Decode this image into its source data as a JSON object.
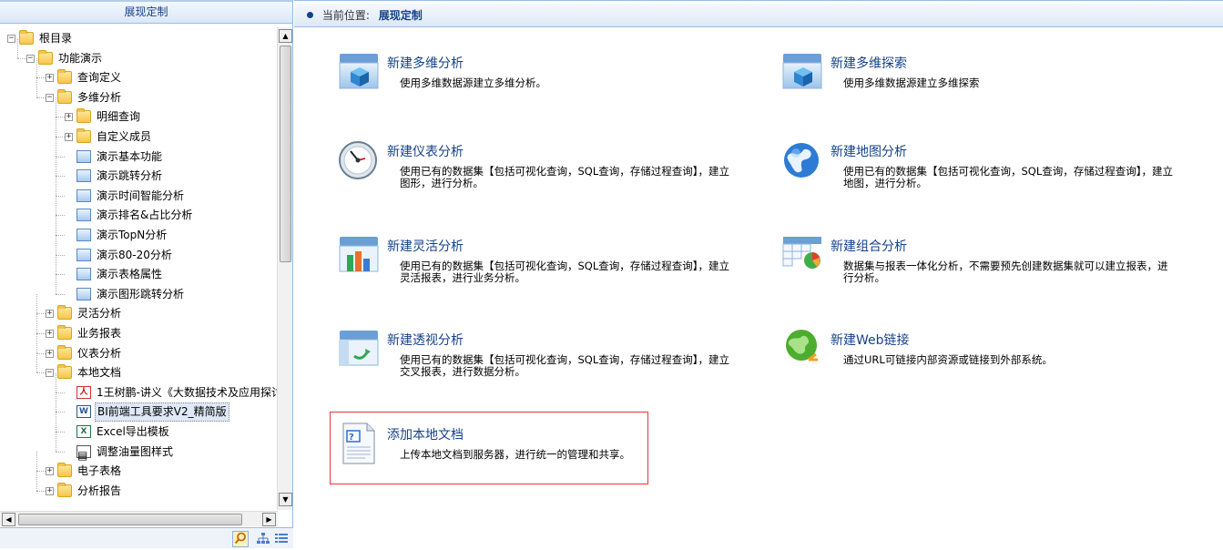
{
  "left_panel": {
    "title": "展现定制",
    "tree": [
      {
        "label": "根目录",
        "level": 0,
        "type": "folder",
        "expanded": true
      },
      {
        "label": "功能演示",
        "level": 1,
        "type": "folder",
        "expanded": true
      },
      {
        "label": "查询定义",
        "level": 2,
        "type": "folder",
        "expanded": false
      },
      {
        "label": "多维分析",
        "level": 2,
        "type": "folder",
        "expanded": true
      },
      {
        "label": "明细查询",
        "level": 3,
        "type": "folder",
        "expanded": false
      },
      {
        "label": "自定义成员",
        "level": 3,
        "type": "folder",
        "expanded": false
      },
      {
        "label": "演示基本功能",
        "level": 3,
        "type": "report"
      },
      {
        "label": "演示跳转分析",
        "level": 3,
        "type": "report"
      },
      {
        "label": "演示时间智能分析",
        "level": 3,
        "type": "report"
      },
      {
        "label": "演示排名&占比分析",
        "level": 3,
        "type": "report"
      },
      {
        "label": "演示TopN分析",
        "level": 3,
        "type": "report"
      },
      {
        "label": "演示80-20分析",
        "level": 3,
        "type": "report"
      },
      {
        "label": "演示表格属性",
        "level": 3,
        "type": "report"
      },
      {
        "label": "演示图形跳转分析",
        "level": 3,
        "type": "report"
      },
      {
        "label": "灵活分析",
        "level": 2,
        "type": "folder",
        "expanded": false
      },
      {
        "label": "业务报表",
        "level": 2,
        "type": "folder",
        "expanded": false
      },
      {
        "label": "仪表分析",
        "level": 2,
        "type": "folder",
        "expanded": false
      },
      {
        "label": "本地文档",
        "level": 2,
        "type": "folder",
        "expanded": true
      },
      {
        "label": "1王树鹏-讲义《大数据技术及应用探讨",
        "level": 3,
        "type": "pdf"
      },
      {
        "label": "BI前端工具要求V2_精简版",
        "level": 3,
        "type": "doc",
        "selected": true
      },
      {
        "label": "Excel导出模板",
        "level": 3,
        "type": "xls"
      },
      {
        "label": "调整油量图样式",
        "level": 3,
        "type": "tpl"
      },
      {
        "label": "电子表格",
        "level": 2,
        "type": "folder",
        "expanded": false
      },
      {
        "label": "分析报告",
        "level": 2,
        "type": "folder",
        "expanded": false
      }
    ]
  },
  "breadcrumb": {
    "label": "当前位置:",
    "current": "展现定制"
  },
  "items": [
    {
      "id": "new-olap",
      "title": "新建多维分析",
      "desc": "使用多维数据源建立多维分析。",
      "icon": "cube-icon"
    },
    {
      "id": "new-olap-explore",
      "title": "新建多维探索",
      "desc": "使用多维数据源建立多维探索",
      "icon": "cube-icon"
    },
    {
      "id": "new-gauge",
      "title": "新建仪表分析",
      "desc": "使用已有的数据集【包括可视化查询，SQL查询，存储过程查询】，建立图形，进行分析。",
      "icon": "gauge-icon"
    },
    {
      "id": "new-map",
      "title": "新建地图分析",
      "desc": "使用已有的数据集【包括可视化查询，SQL查询，存储过程查询】，建立地图，进行分析。",
      "icon": "globe-icon"
    },
    {
      "id": "new-flex",
      "title": "新建灵活分析",
      "desc": "使用已有的数据集【包括可视化查询，SQL查询，存储过程查询】，建立灵活报表，进行业务分析。",
      "icon": "bar-chart-icon"
    },
    {
      "id": "new-combo",
      "title": "新建组合分析",
      "desc": "数据集与报表一体化分析，不需要预先创建数据集就可以建立报表，进行分析。",
      "icon": "table-chart-icon"
    },
    {
      "id": "new-pivot",
      "title": "新建透视分析",
      "desc": "使用已有的数据集【包括可视化查询，SQL查询，存储过程查询】，建立交叉报表，进行数据分析。",
      "icon": "pivot-icon"
    },
    {
      "id": "new-web-link",
      "title": "新建Web链接",
      "desc": "通过URL可链接内部资源或链接到外部系统。",
      "icon": "web-globe-icon"
    },
    {
      "id": "add-local-doc",
      "title": "添加本地文档",
      "desc": "上传本地文档到服务器，进行统一的管理和共享。",
      "icon": "document-icon"
    }
  ]
}
